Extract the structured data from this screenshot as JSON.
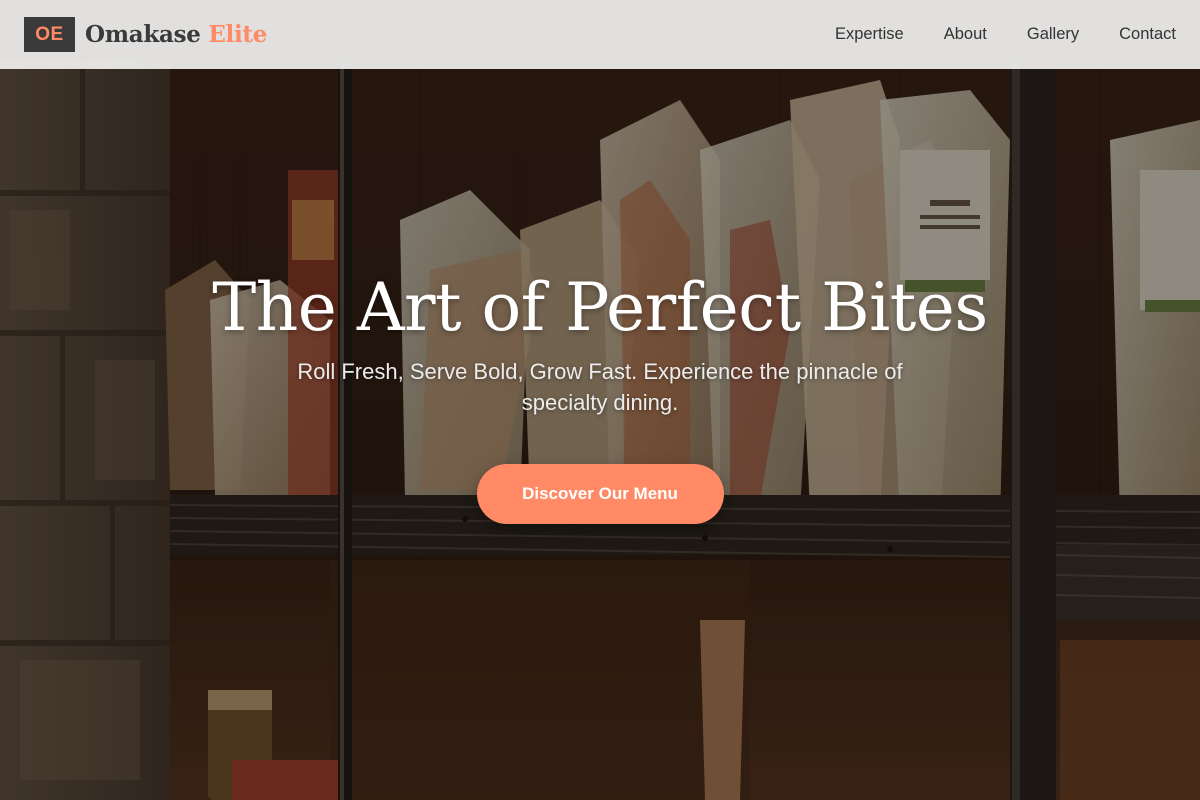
{
  "nav": {
    "logo_initials": "OE",
    "brand_primary": "Omakase",
    "brand_accent": "Elite",
    "links": [
      {
        "label": "Expertise"
      },
      {
        "label": "About"
      },
      {
        "label": "Gallery"
      },
      {
        "label": "Contact"
      }
    ]
  },
  "hero": {
    "title": "The Art of Perfect Bites",
    "subtitle": "Roll Fresh, Serve Bold, Grow Fast. Experience the pinnacle of specialty dining.",
    "cta_label": "Discover Our Menu"
  },
  "colors": {
    "accent": "#ff8a65",
    "logo_bg": "#3a3a3a",
    "nav_bg": "#f0f0ee",
    "hero_overlay": "rgba(10,6,4,0.42)"
  },
  "icons": {
    "hero_background": "pasta-shelf-photo"
  }
}
